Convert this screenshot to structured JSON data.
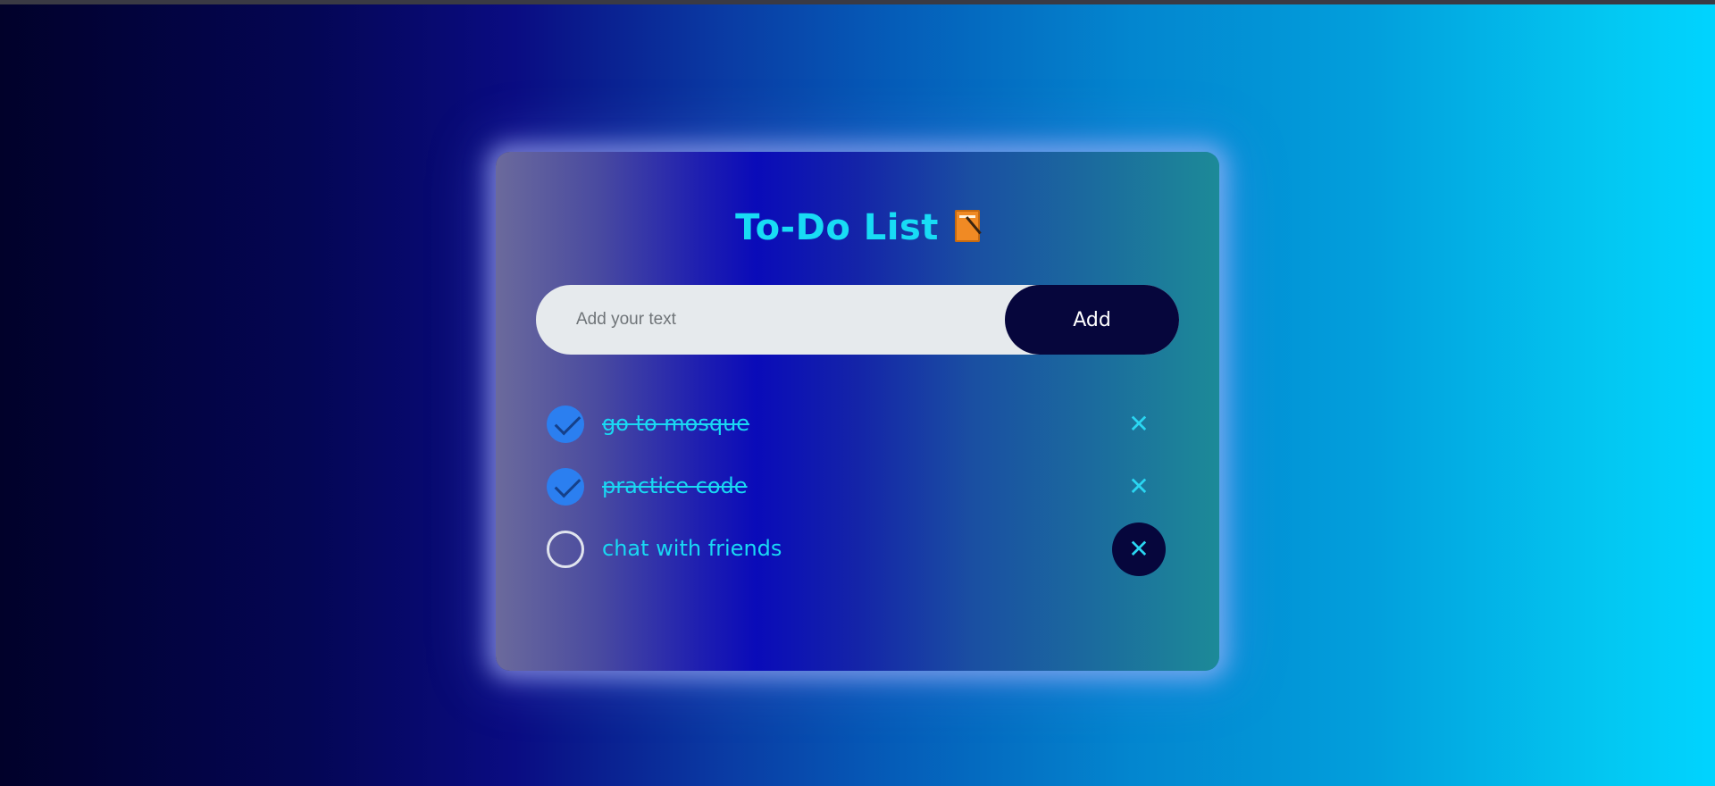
{
  "app": {
    "title": "To-Do List",
    "title_icon": "memo-icon",
    "accent_color": "#18dcf5",
    "icon_color": "#f08a24"
  },
  "input": {
    "placeholder": "Add your text",
    "value": ""
  },
  "add_button": {
    "label": "Add"
  },
  "tasks": [
    {
      "text": "go to mosque",
      "completed": true
    },
    {
      "text": "practice code",
      "completed": true
    },
    {
      "text": "chat with friends",
      "completed": false
    }
  ],
  "delete_label": "✕"
}
